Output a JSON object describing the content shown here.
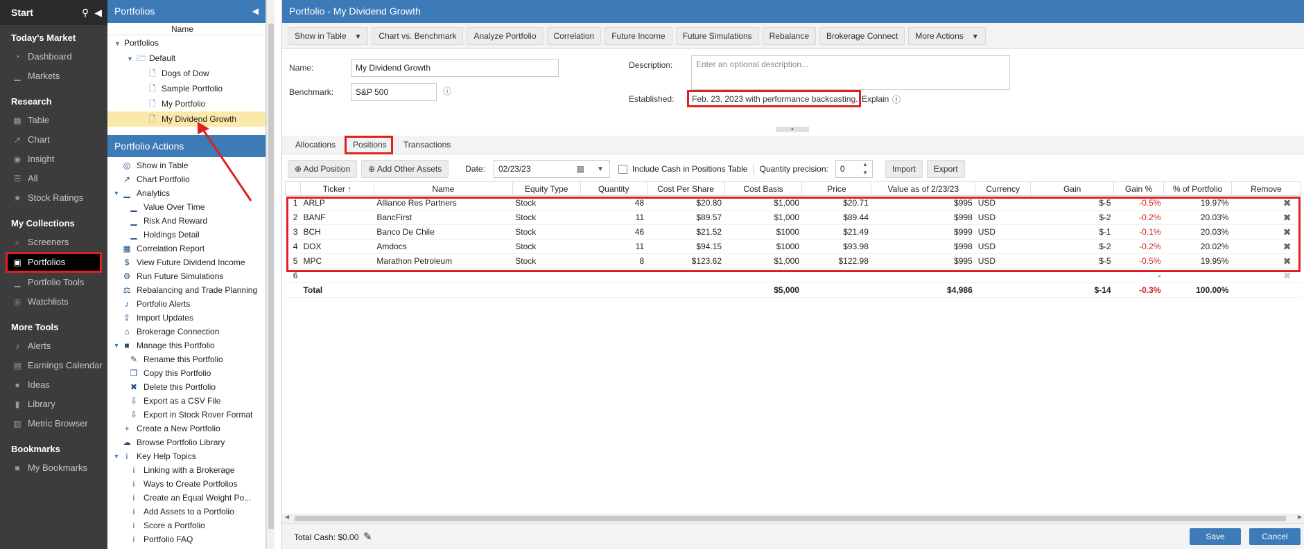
{
  "sidebar": {
    "start": "Start",
    "sections": [
      {
        "title": "Today's Market",
        "items": [
          {
            "label": "Dashboard",
            "icon": "dashboard-icon"
          },
          {
            "label": "Markets",
            "icon": "markets-icon"
          }
        ]
      },
      {
        "title": "Research",
        "items": [
          {
            "label": "Table",
            "icon": "table-icon"
          },
          {
            "label": "Chart",
            "icon": "chart-icon"
          },
          {
            "label": "Insight",
            "icon": "insight-icon"
          },
          {
            "label": "All",
            "icon": "all-icon"
          },
          {
            "label": "Stock Ratings",
            "icon": "star-icon"
          }
        ]
      },
      {
        "title": "My Collections",
        "items": [
          {
            "label": "Screeners",
            "icon": "search-icon"
          },
          {
            "label": "Portfolios",
            "icon": "briefcase-icon",
            "active": true
          },
          {
            "label": "Portfolio Tools",
            "icon": "portfolio-tools-icon"
          },
          {
            "label": "Watchlists",
            "icon": "binoculars-icon"
          }
        ]
      },
      {
        "title": "More Tools",
        "items": [
          {
            "label": "Alerts",
            "icon": "bell-icon"
          },
          {
            "label": "Earnings Calendar",
            "icon": "calendar-icon"
          },
          {
            "label": "Ideas",
            "icon": "lightbulb-icon"
          },
          {
            "label": "Library",
            "icon": "library-icon"
          },
          {
            "label": "Metric Browser",
            "icon": "metric-icon"
          }
        ]
      },
      {
        "title": "Bookmarks",
        "items": [
          {
            "label": "My Bookmarks",
            "icon": "bookmark-icon"
          }
        ]
      }
    ]
  },
  "tree": {
    "title": "Portfolios",
    "col": "Name",
    "root": "Portfolios",
    "folder": "Default",
    "items": [
      "Dogs of Dow",
      "Sample Portfolio",
      "My Portfolio",
      "My Dividend Growth"
    ]
  },
  "actions": {
    "title": "Portfolio Actions",
    "items": [
      {
        "label": "Show in Table",
        "lvl": 0,
        "icon": "binoculars-icon"
      },
      {
        "label": "Chart Portfolio",
        "lvl": 0,
        "icon": "chart-icon"
      },
      {
        "label": "Analytics",
        "lvl": 0,
        "icon": "analytics-icon",
        "toggle": true
      },
      {
        "label": "Value Over Time",
        "lvl": 1,
        "icon": "analytics-icon"
      },
      {
        "label": "Risk And Reward",
        "lvl": 1,
        "icon": "analytics-icon"
      },
      {
        "label": "Holdings Detail",
        "lvl": 1,
        "icon": "analytics-icon"
      },
      {
        "label": "Correlation Report",
        "lvl": 0,
        "icon": "grid-icon"
      },
      {
        "label": "View Future Dividend Income",
        "lvl": 0,
        "icon": "dollar-icon"
      },
      {
        "label": "Run Future Simulations",
        "lvl": 0,
        "icon": "simulation-icon"
      },
      {
        "label": "Rebalancing and Trade Planning",
        "lvl": 0,
        "icon": "scale-icon"
      },
      {
        "label": "Portfolio Alerts",
        "lvl": 0,
        "icon": "bell-icon"
      },
      {
        "label": "Import Updates",
        "lvl": 0,
        "icon": "upload-icon"
      },
      {
        "label": "Brokerage Connection",
        "lvl": 0,
        "icon": "bank-icon"
      },
      {
        "label": "Manage this Portfolio",
        "lvl": 0,
        "icon": "folder-icon",
        "toggle": true
      },
      {
        "label": "Rename this Portfolio",
        "lvl": 1,
        "icon": "edit-icon"
      },
      {
        "label": "Copy this Portfolio",
        "lvl": 1,
        "icon": "copy-icon"
      },
      {
        "label": "Delete this Portfolio",
        "lvl": 1,
        "icon": "trash-icon"
      },
      {
        "label": "Export as a CSV File",
        "lvl": 1,
        "icon": "download-icon"
      },
      {
        "label": "Export in Stock Rover Format",
        "lvl": 1,
        "icon": "download-icon"
      },
      {
        "label": "Create a New Portfolio",
        "lvl": 0,
        "icon": "plus-icon"
      },
      {
        "label": "Browse Portfolio Library",
        "lvl": 0,
        "icon": "cloud-download-icon"
      },
      {
        "label": "Key Help Topics",
        "lvl": 0,
        "icon": "info-icon",
        "toggle": true
      },
      {
        "label": "Linking with a Brokerage",
        "lvl": 1,
        "icon": "info-icon"
      },
      {
        "label": "Ways to Create Portfolios",
        "lvl": 1,
        "icon": "info-icon"
      },
      {
        "label": "Create an Equal Weight Po...",
        "lvl": 1,
        "icon": "info-icon"
      },
      {
        "label": "Add Assets to a Portfolio",
        "lvl": 1,
        "icon": "info-icon"
      },
      {
        "label": "Score a Portfolio",
        "lvl": 1,
        "icon": "info-icon"
      },
      {
        "label": "Portfolio FAQ",
        "lvl": 1,
        "icon": "info-icon"
      }
    ]
  },
  "main": {
    "title": "Portfolio - My Dividend Growth",
    "toolbar": [
      {
        "label": "Show in Table",
        "dd": true
      },
      {
        "label": "Chart vs. Benchmark"
      },
      {
        "label": "Analyze Portfolio"
      },
      {
        "label": "Correlation"
      },
      {
        "label": "Future Income"
      },
      {
        "label": "Future Simulations"
      },
      {
        "label": "Rebalance"
      },
      {
        "label": "Brokerage Connect"
      },
      {
        "label": "More Actions",
        "dd": true
      }
    ],
    "form": {
      "name_label": "Name:",
      "name_value": "My Dividend Growth",
      "bench_label": "Benchmark:",
      "bench_value": "S&P 500",
      "desc_label": "Description:",
      "desc_placeholder": "Enter an optional description...",
      "est_label": "Established:",
      "est_value": "Feb. 23, 2023 with performance backcasting.",
      "explain": "Explain"
    },
    "tabs": [
      "Allocations",
      "Positions",
      "Transactions"
    ],
    "tools": {
      "add_position": "Add Position",
      "add_other": "Add Other Assets",
      "date_label": "Date:",
      "date_value": "02/23/23",
      "cash_label": "Include Cash in Positions Table",
      "qty_label": "Quantity precision:",
      "qty_value": "0",
      "import": "Import",
      "export": "Export"
    },
    "columns": [
      "",
      "Ticker",
      "Name",
      "Equity Type",
      "Quantity",
      "Cost Per Share",
      "Cost Basis",
      "Price",
      "Value as of 2/23/23",
      "Currency",
      "Gain",
      "Gain %",
      "% of Portfolio",
      "Remove"
    ],
    "rows": [
      [
        "1",
        "ARLP",
        "Alliance Res Partners",
        "Stock",
        "48",
        "$20.80",
        "$1,000",
        "$20.71",
        "$995",
        "USD",
        "$-5",
        "-0.5%",
        "19.97%"
      ],
      [
        "2",
        "BANF",
        "BancFirst",
        "Stock",
        "11",
        "$89.57",
        "$1,000",
        "$89.44",
        "$998",
        "USD",
        "$-2",
        "-0.2%",
        "20.03%"
      ],
      [
        "3",
        "BCH",
        "Banco De Chile",
        "Stock",
        "46",
        "$21.52",
        "$1000",
        "$21.49",
        "$999",
        "USD",
        "$-1",
        "-0.1%",
        "20.03%"
      ],
      [
        "4",
        "DOX",
        "Amdocs",
        "Stock",
        "11",
        "$94.15",
        "$1000",
        "$93.98",
        "$998",
        "USD",
        "$-2",
        "-0.2%",
        "20.02%"
      ],
      [
        "5",
        "MPC",
        "Marathon Petroleum",
        "Stock",
        "8",
        "$123.62",
        "$1,000",
        "$122.98",
        "$995",
        "USD",
        "$-5",
        "-0.5%",
        "19.95%"
      ]
    ],
    "empty_row": "6",
    "empty_gainpct": "-",
    "total": {
      "label": "Total",
      "cost_basis": "$5,000",
      "value": "$4,986",
      "gain": "$-14",
      "gain_pct": "-0.3%",
      "pct": "100.00%"
    },
    "footer": {
      "cash": "Total Cash: $0.00",
      "save": "Save",
      "cancel": "Cancel"
    }
  }
}
